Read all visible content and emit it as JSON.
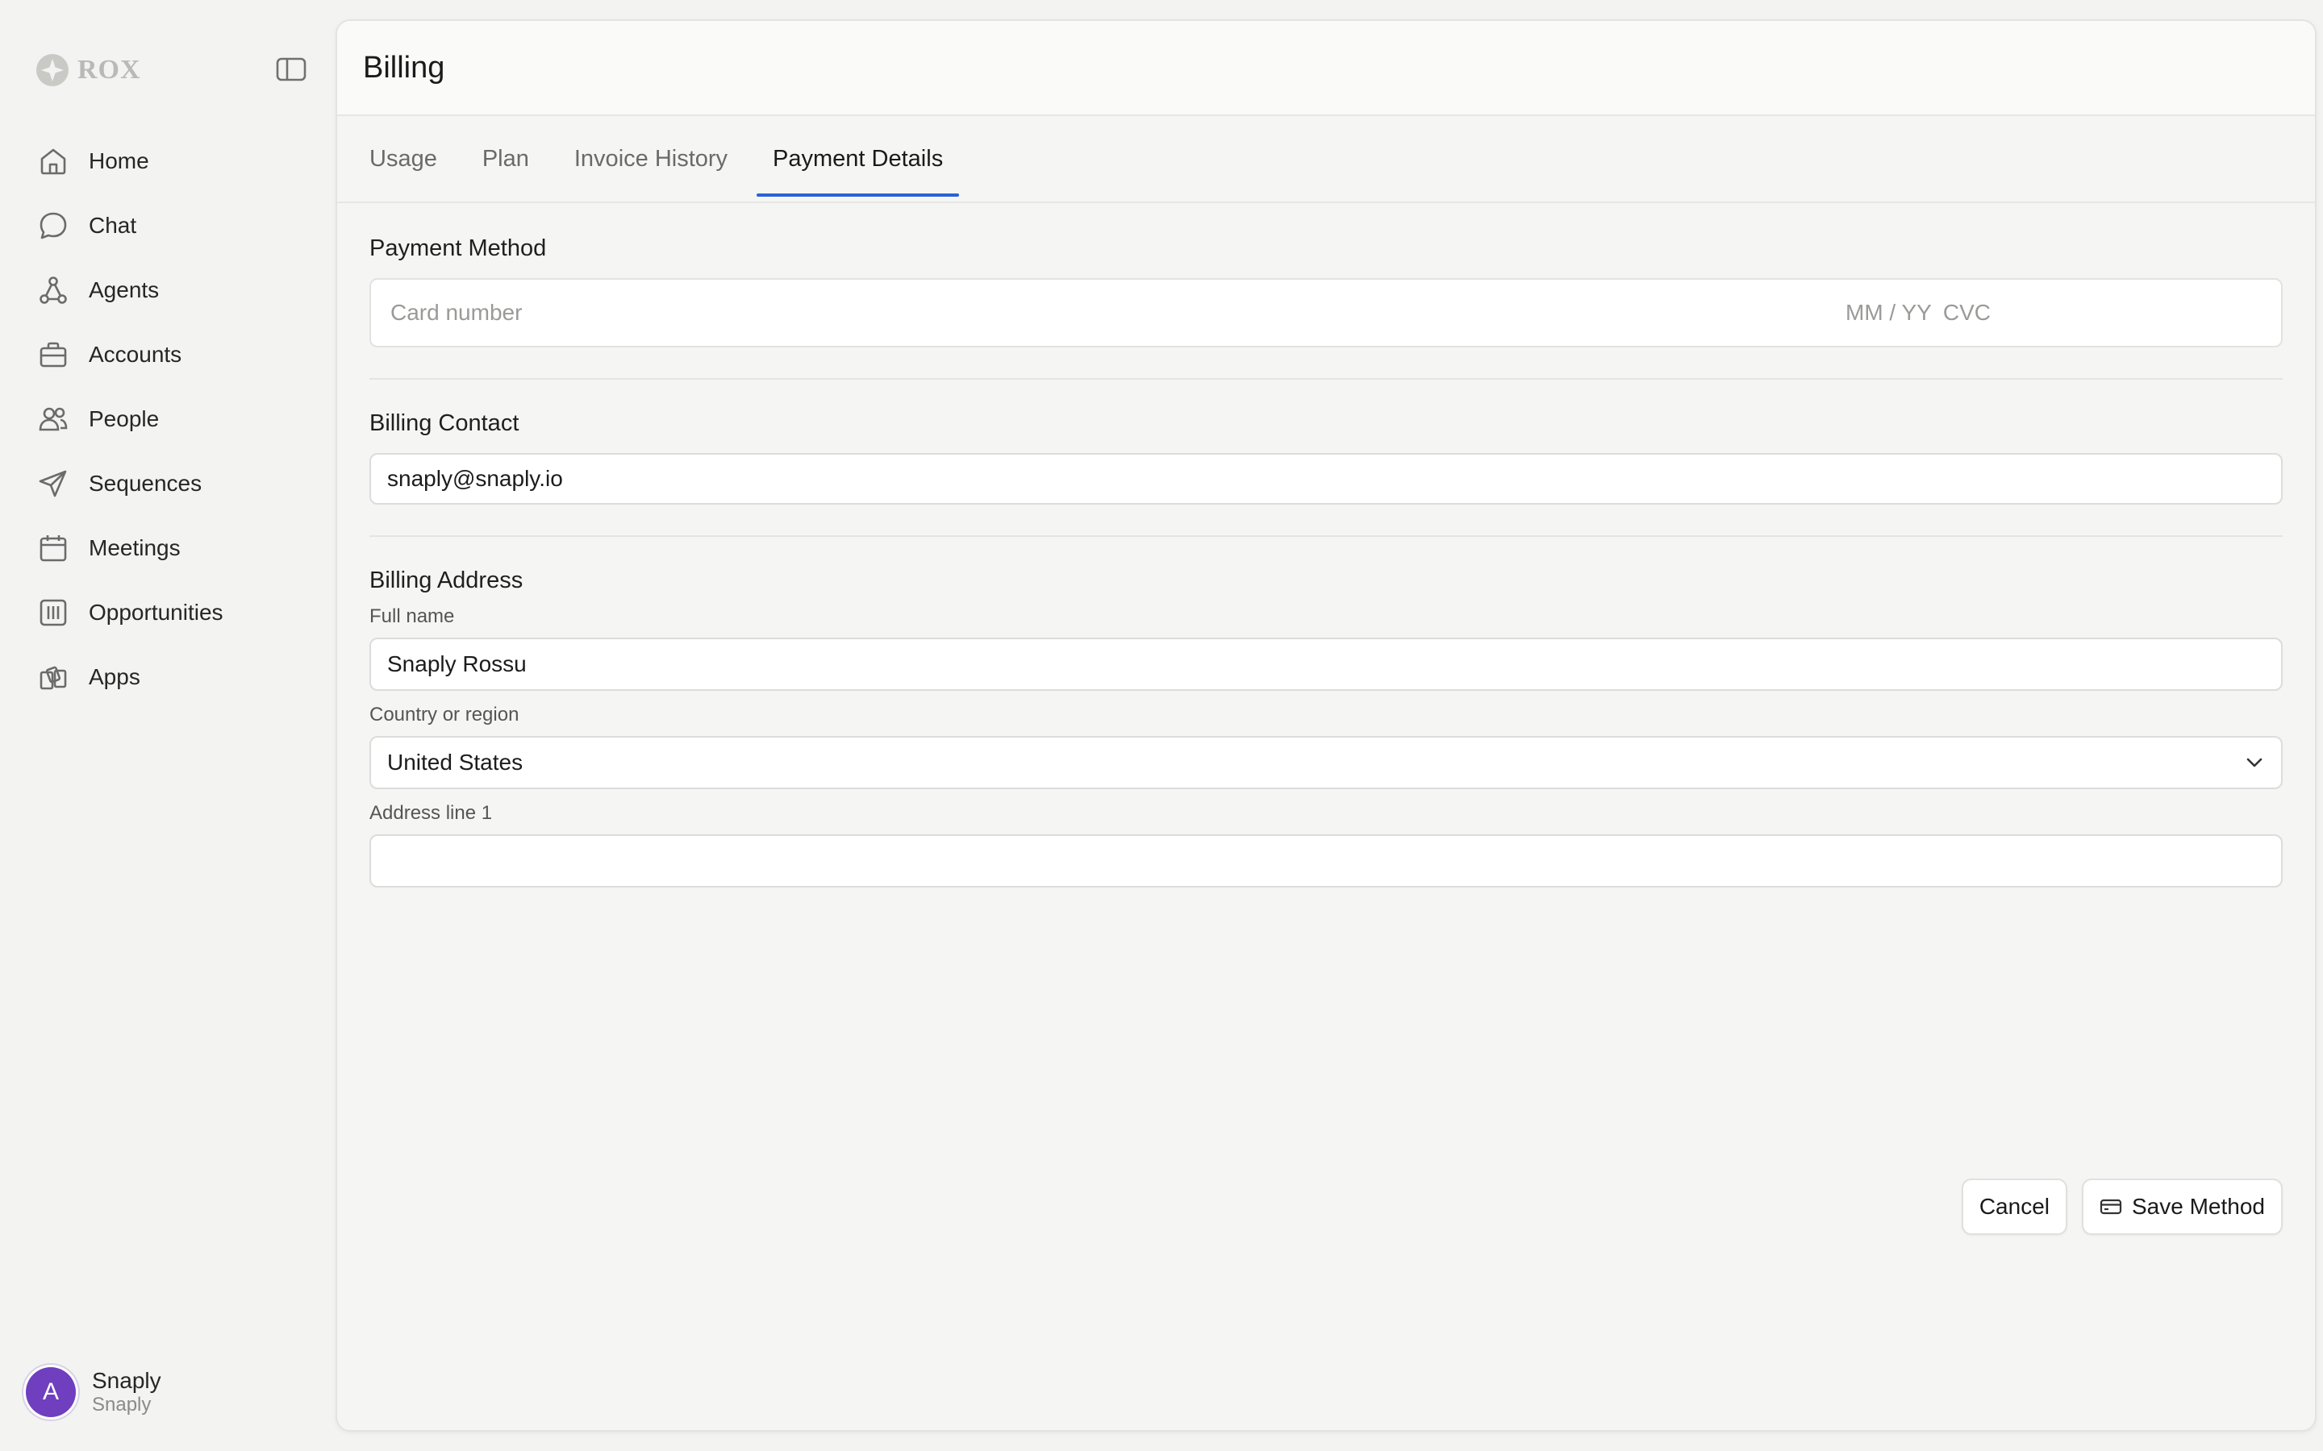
{
  "brand": {
    "name": "ROX"
  },
  "sidebar": {
    "items": [
      {
        "label": "Home",
        "icon": "home-icon"
      },
      {
        "label": "Chat",
        "icon": "chat-bubble-icon"
      },
      {
        "label": "Agents",
        "icon": "agents-network-icon"
      },
      {
        "label": "Accounts",
        "icon": "briefcase-icon"
      },
      {
        "label": "People",
        "icon": "people-icon"
      },
      {
        "label": "Sequences",
        "icon": "paper-plane-icon"
      },
      {
        "label": "Meetings",
        "icon": "calendar-icon"
      },
      {
        "label": "Opportunities",
        "icon": "columns-icon"
      },
      {
        "label": "Apps",
        "icon": "apps-icon"
      }
    ],
    "user": {
      "initial": "A",
      "name": "Snaply",
      "org": "Snaply"
    }
  },
  "header": {
    "title": "Billing"
  },
  "tabs": [
    {
      "label": "Usage",
      "active": false
    },
    {
      "label": "Plan",
      "active": false
    },
    {
      "label": "Invoice History",
      "active": false
    },
    {
      "label": "Payment Details",
      "active": true
    }
  ],
  "payment_method": {
    "title": "Payment Method",
    "card_placeholder": "Card number",
    "expiry_placeholder": "MM / YY",
    "cvc_placeholder": "CVC"
  },
  "billing_contact": {
    "title": "Billing Contact",
    "email": "snaply@snaply.io"
  },
  "billing_address": {
    "title": "Billing Address",
    "full_name_label": "Full name",
    "full_name_value": "Snaply Rossu",
    "country_label": "Country or region",
    "country_value": "United States",
    "address1_label": "Address line 1",
    "address1_value": ""
  },
  "actions": {
    "cancel_label": "Cancel",
    "save_label": "Save Method"
  },
  "colors": {
    "accent": "#2a62d6",
    "avatar": "#6f3fbf",
    "background": "#f3f3f2"
  }
}
